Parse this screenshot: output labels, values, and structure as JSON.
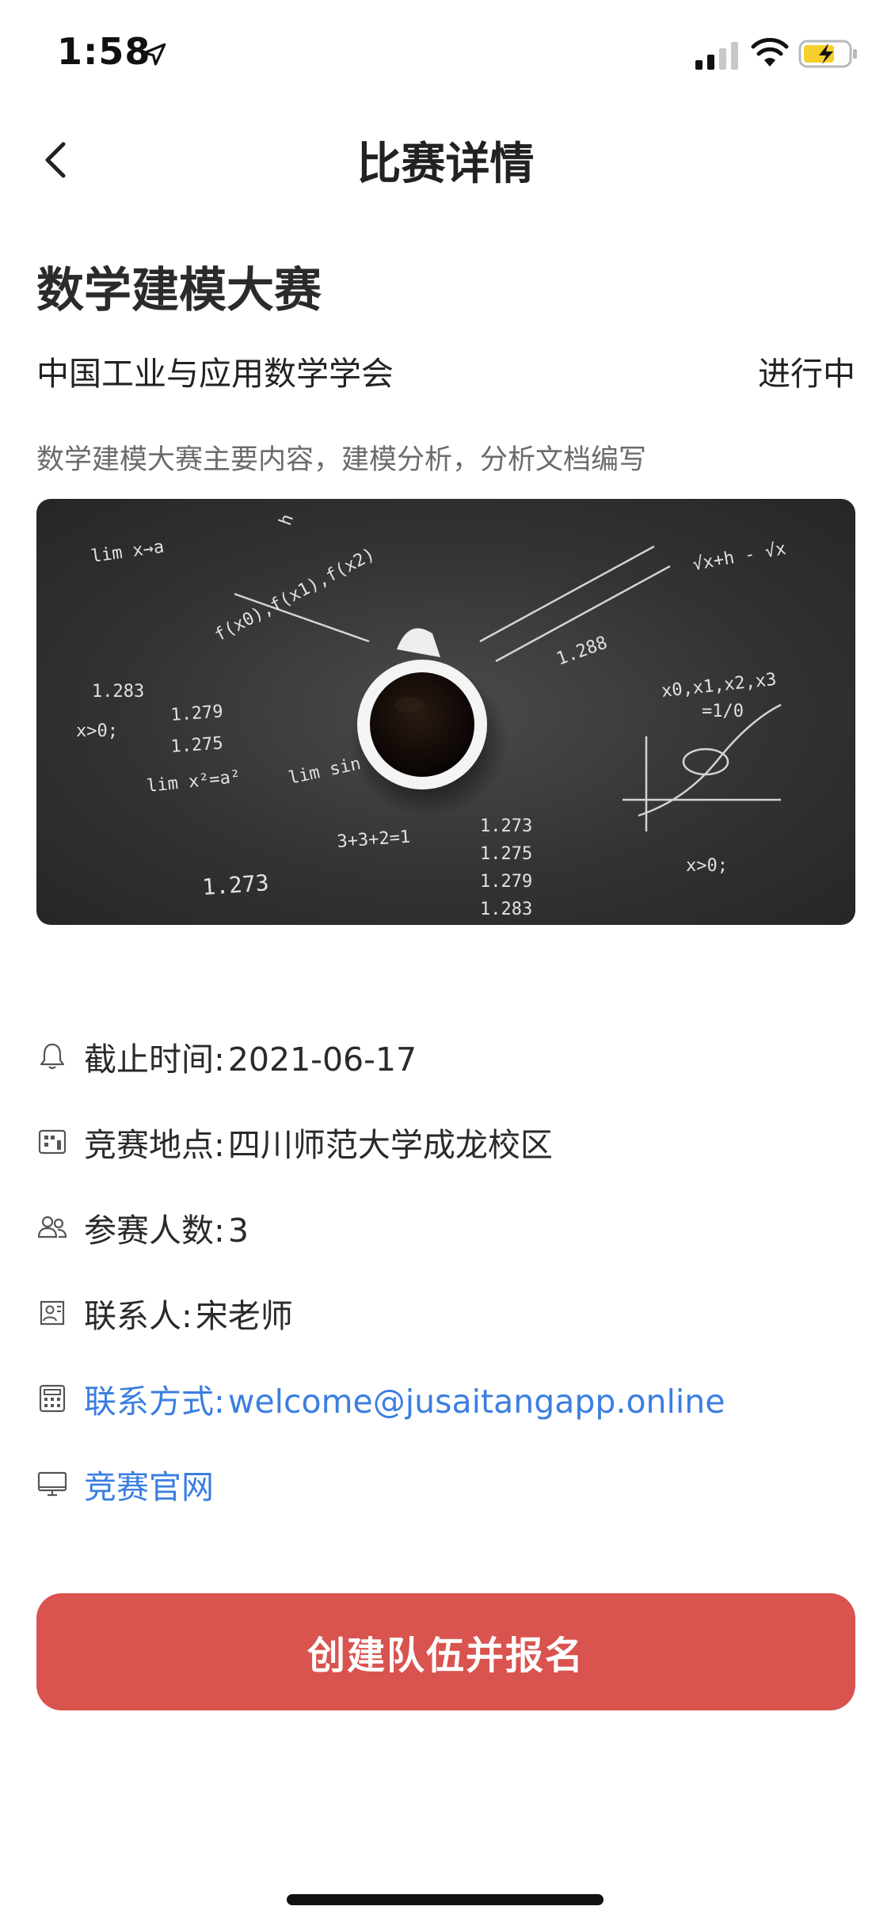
{
  "status_bar": {
    "time": "1:58",
    "icons": [
      "location-arrow-icon",
      "signal-icon",
      "wifi-icon",
      "battery-charging-icon"
    ]
  },
  "nav": {
    "back_icon": "chevron-left-icon",
    "title": "比赛详情"
  },
  "competition": {
    "name": "数学建模大赛",
    "organizer": "中国工业与应用数学学会",
    "status": "进行中",
    "description": "数学建模大赛主要内容，建模分析，分析文档编写",
    "banner_formulas": [
      "lim x→a",
      "1.273",
      "1.275",
      "1.279",
      "1.283",
      "x>0;",
      "lim x²=a²",
      "f(x0),f(x1),f(x2)",
      "x0,x1,x2,x3",
      "=1/0",
      "√x+h - √x",
      "h",
      "1.288",
      "3+3+2=1",
      "lim sin"
    ]
  },
  "info": {
    "deadline_label": "截止时间:",
    "deadline_value": "2021-06-17",
    "location_label": "竞赛地点:",
    "location_value": "四川师范大学成龙校区",
    "participants_label": "参赛人数:",
    "participants_value": "3",
    "contact_person_label": "联系人:",
    "contact_person_value": "宋老师",
    "contact_method_label": "联系方式:",
    "contact_method_value": "welcome@jusaitangapp.online",
    "website_label": "竞赛官网"
  },
  "cta": {
    "label": "创建队伍并报名"
  },
  "colors": {
    "accent_link": "#3b7ee0",
    "cta_background": "#d9534f",
    "banner_background": "#333333",
    "battery_fill": "#f5cf2e"
  }
}
